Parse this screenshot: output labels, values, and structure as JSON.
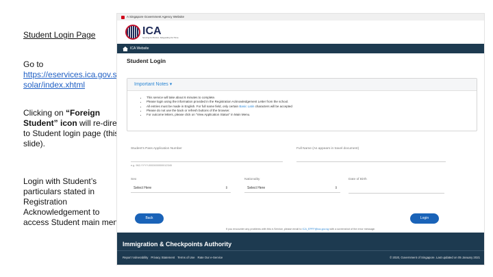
{
  "slide": {
    "title": "Student Login Page",
    "goto_prefix": "Go to",
    "goto_link": "https://eservices.ica.gov.sg/solar/index.xhtml",
    "p2_a": "Clicking on",
    "p2_bold": "“Foreign Student” icon",
    "p2_b": "will re-direct to Student login page (this slide).",
    "p3": "Login with Student’s particulars stated in Registration Acknowledgement to access Student main menu."
  },
  "gov_banner": "A Singapore Government Agency Website",
  "logo": {
    "main": "ICA",
    "sub": "Securing Our Borders, Safeguarding Our Home"
  },
  "nav": {
    "home_label": "ICA Website"
  },
  "page_title": "Student Login",
  "notes": {
    "heading": "Important Notes",
    "items": [
      "This service will take about 6 minutes to complete.",
      "Please login using the information provided in the Registration Acknowledgement Letter from the school.",
      "All entries must be made in English. For full name field, only certain",
      "Please do not use the back or refresh buttons of the browser.",
      "For outcome letters, please click on \"View Application Status\" in Main Menu."
    ],
    "item3_link": "Basic Latin",
    "item3_tail": "characters will be accepted"
  },
  "form": {
    "pass_label": "Student's Pass Application Number",
    "pass_hint": "e.g. 962-YYYY-0000000000012345",
    "name_label": "Full Name (As appears in travel document)",
    "sex_label": "Sex",
    "sex_value": "Select Here",
    "nationality_label": "Nationality",
    "nationality_value": "Select Here",
    "dob_label": "Date of Birth"
  },
  "buttons": {
    "back": "Back",
    "login": "Login"
  },
  "help": {
    "prefix": "If you encounter any problems with this e-Service, please email to",
    "email": "ICA_EPFF@ica.gov.sg",
    "suffix": "with a screenshot of the error message."
  },
  "footer": {
    "title": "Immigration & Checkpoints Authority",
    "links": [
      "Report Vulnerability",
      "Privacy Statement",
      "Terms of Use",
      "Rate Our e-Service"
    ],
    "copyright": "© 2020, Government of Singapore. Last updated on 05 January 2021"
  }
}
